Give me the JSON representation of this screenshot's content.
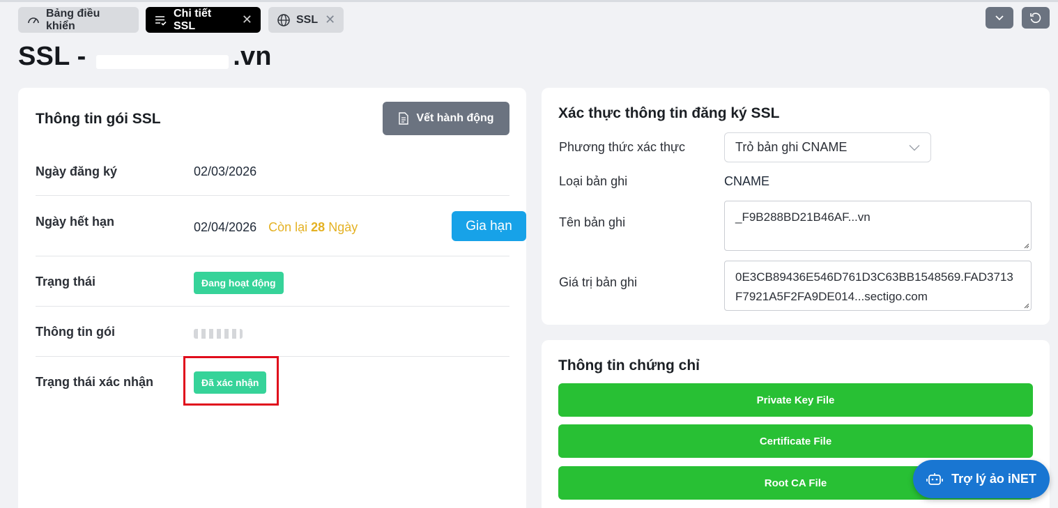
{
  "tabs": [
    {
      "label": "Bảng điều khiển",
      "icon": "dashboard-gauge-icon",
      "closable": false
    },
    {
      "label": "Chi tiết SSL",
      "icon": "list-check-icon",
      "closable": true
    },
    {
      "label": "SSL",
      "icon": "globe-icon",
      "closable": true
    }
  ],
  "close_glyph": "✕",
  "page": {
    "title_prefix": "SSL - ",
    "title_suffix": ".vn"
  },
  "package_info": {
    "title": "Thông tin gói SSL",
    "log_button": "Vết hành động",
    "rows": {
      "reg_date_label": "Ngày đăng ký",
      "reg_date_value": "02/03/2026",
      "exp_date_label": "Ngày hết hạn",
      "exp_date_value": "02/04/2026",
      "remaining_prefix": "Còn lại",
      "remaining_days": "28",
      "remaining_suffix": "Ngày",
      "renew_button": "Gia hạn",
      "status_label": "Trạng thái",
      "status_value": "Đang hoạt động",
      "plan_label": "Thông tin gói",
      "verify_status_label": "Trạng thái xác nhận",
      "verify_status_value": "Đã xác nhận"
    }
  },
  "verification": {
    "title": "Xác thực thông tin đăng ký SSL",
    "method_label": "Phương thức xác thực",
    "method_value": "Trỏ bản ghi CNAME",
    "record_type_label": "Loại bản ghi",
    "record_type_value": "CNAME",
    "record_name_label": "Tên bản ghi",
    "record_name_value": "_F9B288BD21B46AF...vn",
    "record_value_label": "Giá trị bản ghi",
    "record_value_value": "0E3CB89436E546D761D3C63BB1548569.FAD3713F7921A5F2FA9DE014...sectigo.com"
  },
  "certificate": {
    "title": "Thông tin chứng chỉ",
    "buttons": [
      "Private Key File",
      "Certificate File",
      "Root CA File"
    ]
  },
  "assistant": {
    "label": "Trợ lý ảo iNET"
  },
  "colors": {
    "accent_blue": "#17a2e8",
    "status_green": "#36d399",
    "download_green": "#28c034",
    "warning_yellow": "#e4b123",
    "highlight_red": "#e00d1c"
  }
}
